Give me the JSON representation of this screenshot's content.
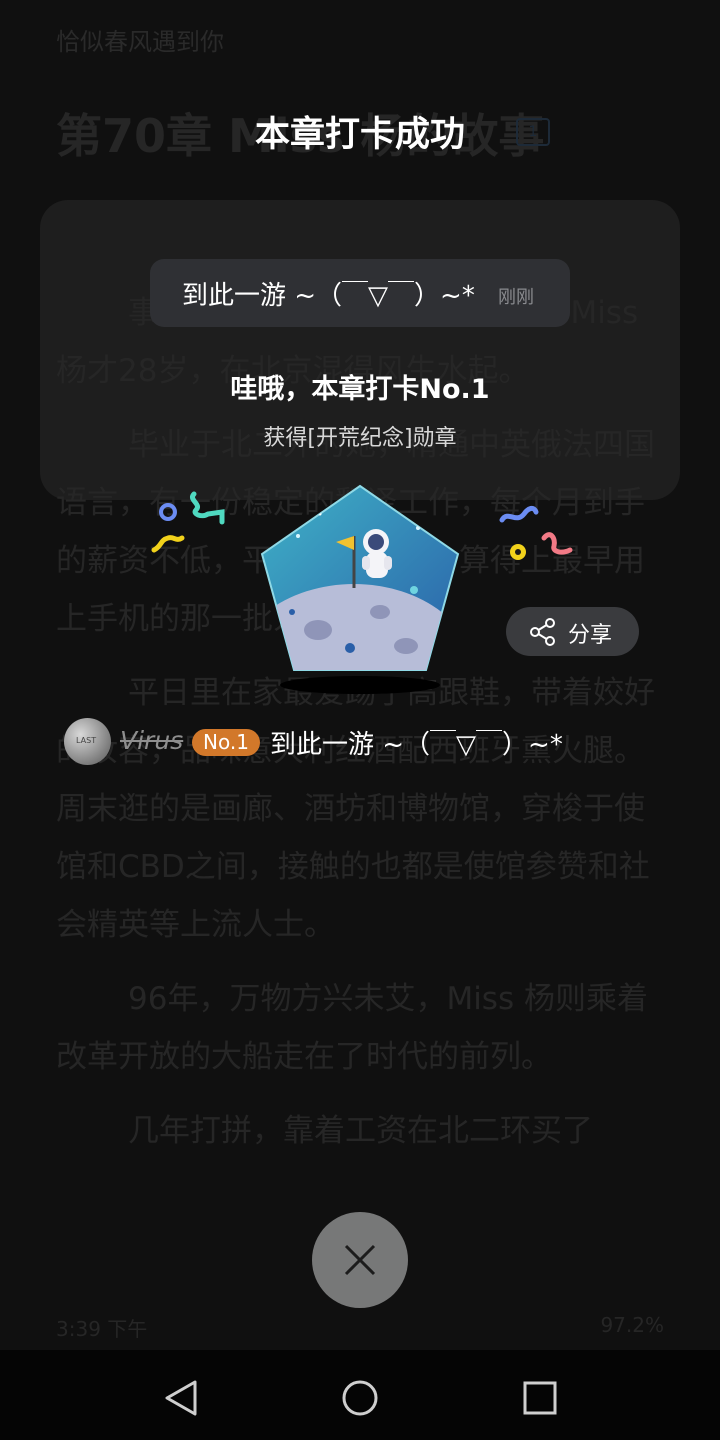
{
  "reader": {
    "book_title": "恰似春风遇到你",
    "chapter_title": "第70章 Miss 杨的故事",
    "chapter_comment_count": "1",
    "paragraphs": [
      "事情还得从80年代说起，那一年Miss杨才28岁，在北京混得风生水起。",
      "毕业于北二外的她，精通中英俄法四国语言，有一份稳定的翻译工作，每个月到手的薪资不低，平日业务繁忙，算得上最早用上手机的那一批人。",
      "平日里在家最爱踢了高跟鞋，带着姣好的妆容，品味意大利红酒配西班牙熏火腿。周末逛的是画廊、酒坊和博物馆，穿梭于使馆和CBD之间，接触的也都是使馆参赞和社会精英等上流人士。",
      "96年，万物方兴未艾，Miss 杨则乘着改革开放的大船走在了时代的前列。",
      "几年打拼，靠着工资在北二环买了"
    ],
    "footer_time": "3:39 下午",
    "footer_progress": "97.2%"
  },
  "popup": {
    "title": "本章打卡成功",
    "comment_text": "到此一游 ~（￣▽￣）~*",
    "comment_time": "刚刚",
    "headline": "哇哦，本章打卡No.1",
    "subline": "获得[开荒纪念]勋章",
    "medal_name": "开荒纪念",
    "share_label": "分享",
    "user": {
      "avatar_text": "LAST",
      "name": "Virus",
      "rank": "No.1",
      "comment": "到此一游 ~（￣▽￣）~*"
    }
  },
  "icons": {
    "share": "share-icon",
    "close": "close-icon",
    "nav_back": "back-triangle-icon",
    "nav_home": "home-circle-icon",
    "nav_recent": "recent-square-icon"
  },
  "colors": {
    "rank_badge": "#d2782a",
    "medal_sky": "#2f8fb3",
    "medal_moon": "#b7bdd8",
    "close_button": "#777878"
  }
}
